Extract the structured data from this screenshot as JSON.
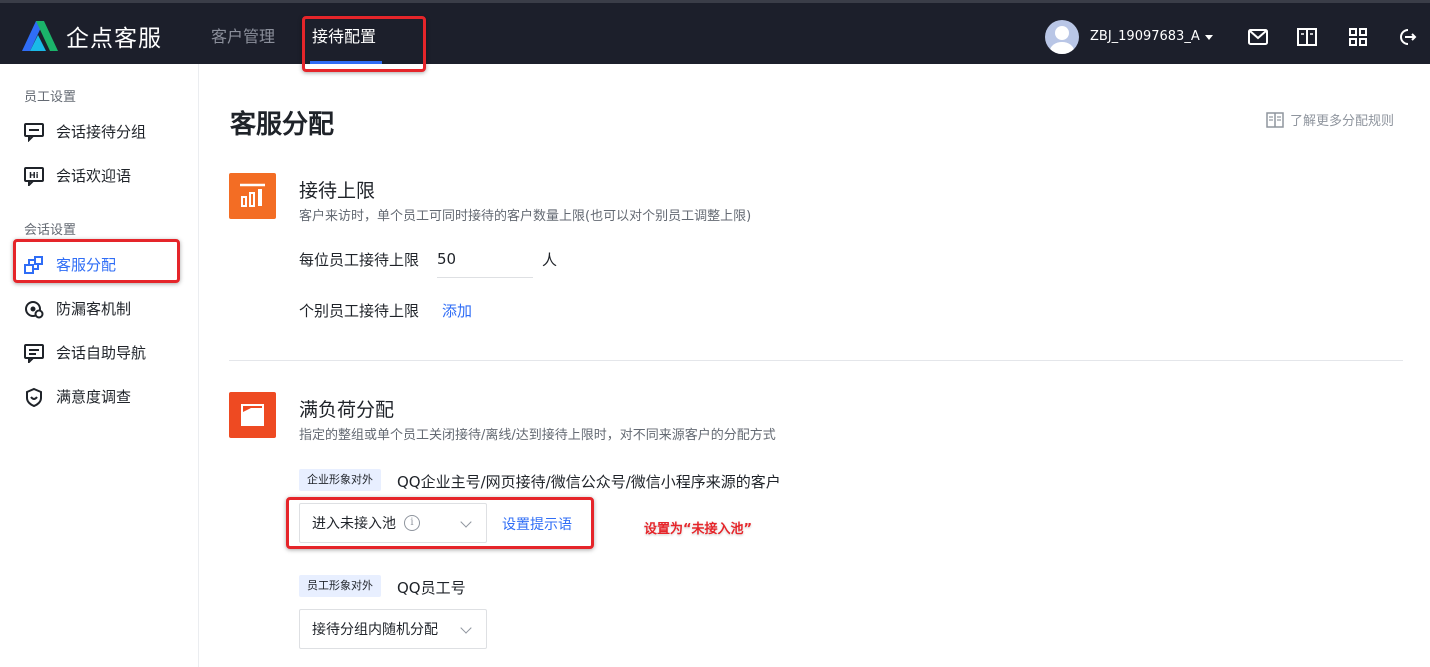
{
  "app": {
    "logo_text": "企点客服",
    "nav": [
      {
        "label": "客户管理"
      },
      {
        "label": "接待配置"
      }
    ],
    "username": "ZBJ_19097683_A",
    "top_icons": [
      "mail-icon",
      "book-icon",
      "grid-icon",
      "logout-icon"
    ]
  },
  "sidebar": {
    "groups": [
      {
        "label": "员工设置",
        "items": [
          {
            "label": "会话接待分组",
            "icon": "chat-group-icon"
          },
          {
            "label": "会话欢迎语",
            "icon": "hi-message-icon"
          }
        ]
      },
      {
        "label": "会话设置",
        "items": [
          {
            "label": "客服分配",
            "icon": "distribution-icon"
          },
          {
            "label": "防漏客机制",
            "icon": "anti-loss-icon"
          },
          {
            "label": "会话自助导航",
            "icon": "self-nav-icon"
          },
          {
            "label": "满意度调查",
            "icon": "satisfaction-icon"
          }
        ]
      }
    ]
  },
  "main": {
    "title": "客服分配",
    "rules_link": "了解更多分配规则",
    "limit_section": {
      "title": "接待上限",
      "desc": "客户来访时，单个员工可同时接待的客户数量上限(也可以对个别员工调整上限)",
      "per_staff_label": "每位员工接待上限",
      "per_staff_value": "50",
      "unit": "人",
      "individual_label": "个别员工接待上限",
      "add_label": "添加"
    },
    "overload_section": {
      "title": "满负荷分配",
      "desc": "指定的整组或单个员工关闭接待/离线/达到接待上限时，对不同来源客户的分配方式",
      "enterprise": {
        "tag": "企业形象对外",
        "sources": "QQ企业主号/网页接待/微信公众号/微信小程序来源的客户",
        "select_value": "进入未接入池",
        "tip_link": "设置提示语"
      },
      "staff": {
        "tag": "员工形象对外",
        "sources": "QQ员工号",
        "select_value": "接待分组内随机分配"
      }
    },
    "annotation": "设置为“未接入池”"
  },
  "colors": {
    "topbar": "#1c1f2b",
    "accent": "#2f6df6",
    "section_icon": "#f36d24",
    "annotation_red": "#e5252a"
  }
}
